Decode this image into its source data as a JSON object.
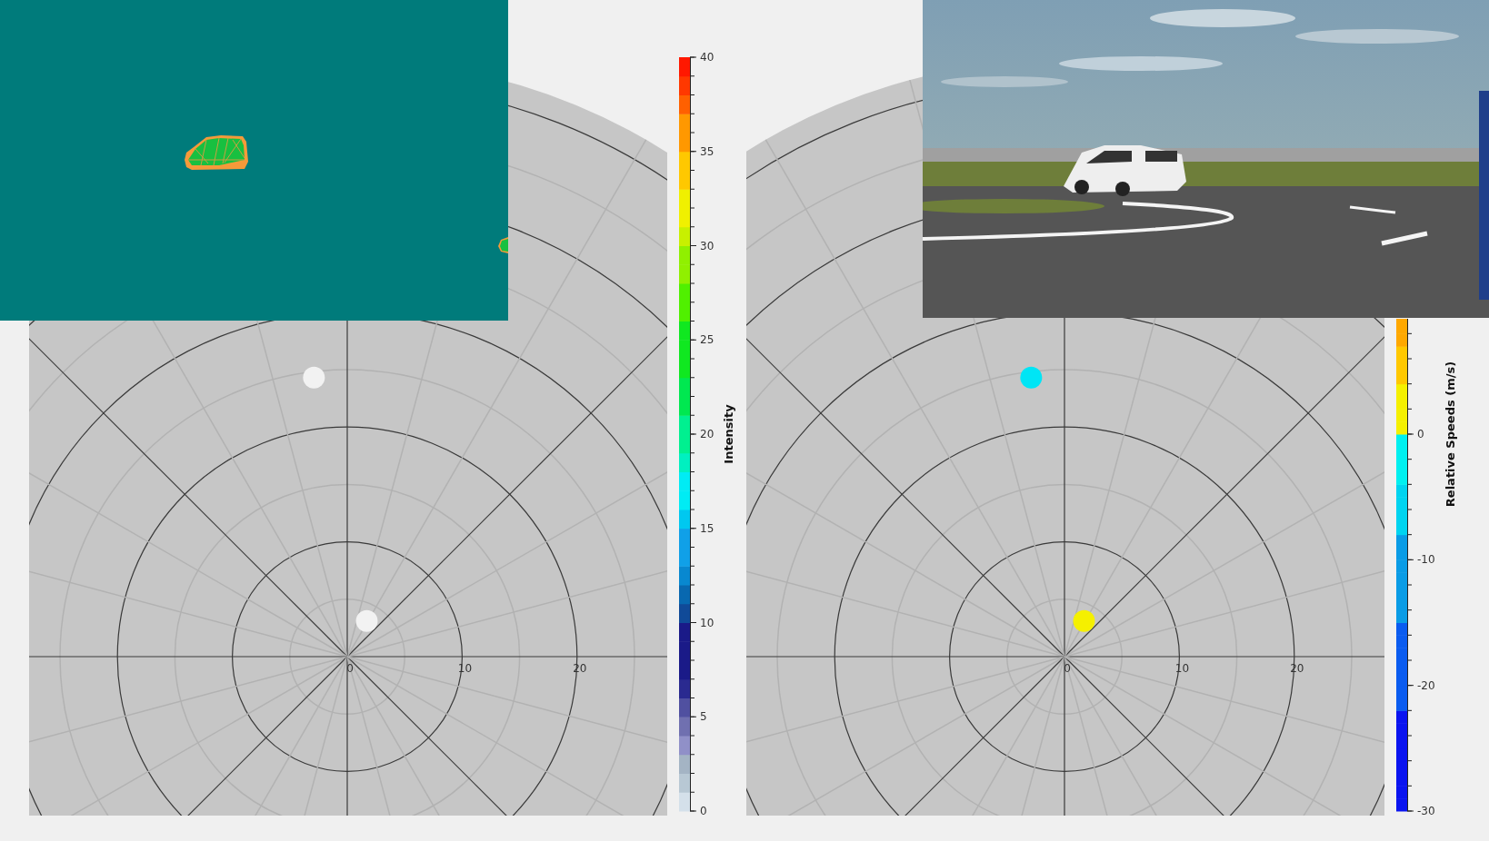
{
  "plots": [
    {
      "axis_ticks": [
        "0",
        "10",
        "20"
      ],
      "detections": [
        {
          "color": "#f2f2f2"
        },
        {
          "color": "#f2f2f2"
        }
      ],
      "colorbar": {
        "kind": "intensity",
        "title": "Intensity",
        "ticks": [
          "40",
          "35",
          "30",
          "25",
          "20",
          "15",
          "10",
          "5",
          "0"
        ]
      }
    },
    {
      "axis_ticks": [
        "0",
        "10",
        "20"
      ],
      "detections": [
        {
          "color": "#00e5f5"
        },
        {
          "color": "#f5f000"
        }
      ],
      "colorbar": {
        "kind": "speed",
        "title": "Relative Speeds (m/s)",
        "ticks": [
          "0",
          "-10",
          "-20",
          "-30"
        ]
      }
    }
  ]
}
